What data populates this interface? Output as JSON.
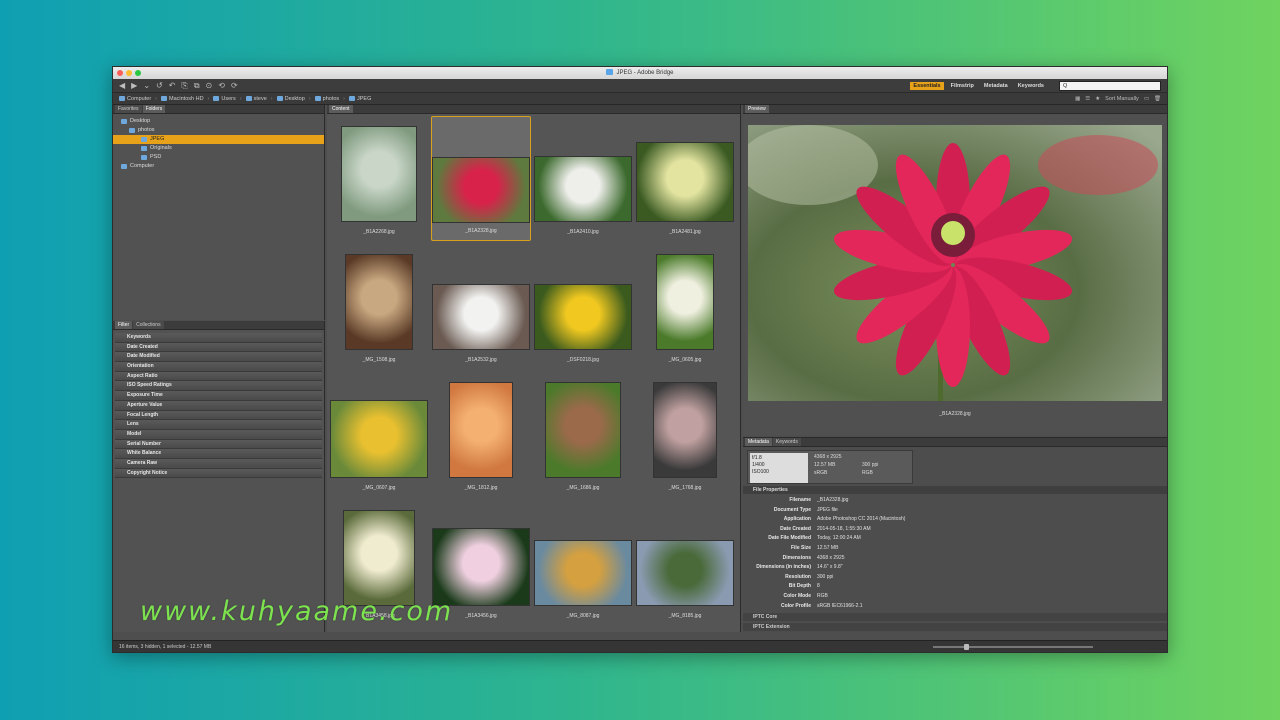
{
  "window": {
    "title": "JPEG - Adobe Bridge"
  },
  "toolbar": {
    "workspaces": [
      {
        "label": "Essentials",
        "active": true
      },
      {
        "label": "Filmstrip",
        "active": false
      },
      {
        "label": "Metadata",
        "active": false
      },
      {
        "label": "Keywords",
        "active": false
      }
    ],
    "search_placeholder": "Q"
  },
  "path": {
    "items": [
      "Computer",
      "Macintosh HD",
      "Users",
      "steve",
      "Desktop",
      "photos",
      "JPEG"
    ],
    "sort_label": "Sort Manually"
  },
  "left_top": {
    "tabs": [
      "Favorites",
      "Folders"
    ],
    "tree": [
      "Desktop",
      "photos",
      "JPEG",
      "Originals",
      "PSD",
      "Computer"
    ]
  },
  "left_bottom": {
    "tabs": [
      "Filter",
      "Collections"
    ],
    "filters": [
      "Keywords",
      "Date Created",
      "Date Modified",
      "Orientation",
      "Aspect Ratio",
      "ISO Speed Ratings",
      "Exposure Time",
      "Aperture Value",
      "Focal Length",
      "Lens",
      "Model",
      "Serial Number",
      "White Balance",
      "Camera Raw",
      "Copyright Notice"
    ]
  },
  "content": {
    "tab": "Content",
    "thumbnails": [
      {
        "name": "_B1A2268.jpg",
        "colors": [
          "#c9d6c8",
          "#7f9a7e"
        ]
      },
      {
        "name": "_B1A2328.jpg",
        "colors": [
          "#d8224a",
          "#5e7a3e"
        ],
        "selected": true
      },
      {
        "name": "_B1A2410.jpg",
        "colors": [
          "#eeeeea",
          "#3c6a2e"
        ]
      },
      {
        "name": "_B1A2481.jpg",
        "colors": [
          "#e3e4a0",
          "#3a5a22"
        ]
      },
      {
        "name": "_MG_1508.jpg",
        "colors": [
          "#c8a880",
          "#5a3a26"
        ]
      },
      {
        "name": "_B1A2532.jpg",
        "colors": [
          "#f2f2f0",
          "#6a5a52"
        ]
      },
      {
        "name": "_DSF0218.jpg",
        "colors": [
          "#f0c820",
          "#3a5a1e"
        ]
      },
      {
        "name": "_MG_0605.jpg",
        "colors": [
          "#f0f0e0",
          "#4a7a2a"
        ]
      },
      {
        "name": "_MG_0607.jpg",
        "colors": [
          "#e8c030",
          "#6a8a3a"
        ]
      },
      {
        "name": "_MG_1812.jpg",
        "colors": [
          "#f4b070",
          "#d07840"
        ]
      },
      {
        "name": "_MG_1686.jpg",
        "colors": [
          "#9a6a4a",
          "#4a7a2a"
        ]
      },
      {
        "name": "_MG_1768.jpg",
        "colors": [
          "#c0a0a0",
          "#3a3a3a"
        ]
      },
      {
        "name": "_B1A3458.jpg",
        "colors": [
          "#f0ecd0",
          "#5a6a3a"
        ]
      },
      {
        "name": "_B1A3456.jpg",
        "colors": [
          "#f0d0e0",
          "#1a3a1a"
        ]
      },
      {
        "name": "_MG_8087.jpg",
        "colors": [
          "#d4a040",
          "#6a8aa0"
        ]
      },
      {
        "name": "_MG_8185.jpg",
        "colors": [
          "#4a6a3a",
          "#8a9ab0"
        ]
      }
    ]
  },
  "preview": {
    "tab": "Preview",
    "caption": "_B1A2328.jpg"
  },
  "metadata": {
    "tabs": [
      "Metadata",
      "Keywords"
    ],
    "camera": {
      "aperture": "f/1.8",
      "shutter": "1/400",
      "iso": "ISO100"
    },
    "info": [
      [
        "4368 x 2925",
        ""
      ],
      [
        "12.57 MB",
        "300 ppi"
      ],
      [
        "sRGB",
        "RGB"
      ]
    ],
    "section": "File Properties",
    "properties": [
      {
        "k": "Filename",
        "v": "_B1A2328.jpg"
      },
      {
        "k": "Document Type",
        "v": "JPEG file"
      },
      {
        "k": "Application",
        "v": "Adobe Photoshop CC 2014 (Macintosh)"
      },
      {
        "k": "Date Created",
        "v": "2014-05-18, 1:55:30 AM"
      },
      {
        "k": "Date File Modified",
        "v": "Today, 12:00:24 AM"
      },
      {
        "k": "File Size",
        "v": "12.57 MB"
      },
      {
        "k": "Dimensions",
        "v": "4368 x 2925"
      },
      {
        "k": "Dimensions (in inches)",
        "v": "14.6\" x 9.8\""
      },
      {
        "k": "Resolution",
        "v": "300 ppi"
      },
      {
        "k": "Bit Depth",
        "v": "8"
      },
      {
        "k": "Color Mode",
        "v": "RGB"
      },
      {
        "k": "Color Profile",
        "v": "sRGB IEC61966-2.1"
      }
    ],
    "more_sections": [
      "IPTC Core",
      "IPTC Extension"
    ]
  },
  "status": {
    "text": "16 items, 3 hidden, 1 selected - 12.57 MB",
    "zoom": 0.2
  },
  "watermark": "www.kuhyaame.com"
}
